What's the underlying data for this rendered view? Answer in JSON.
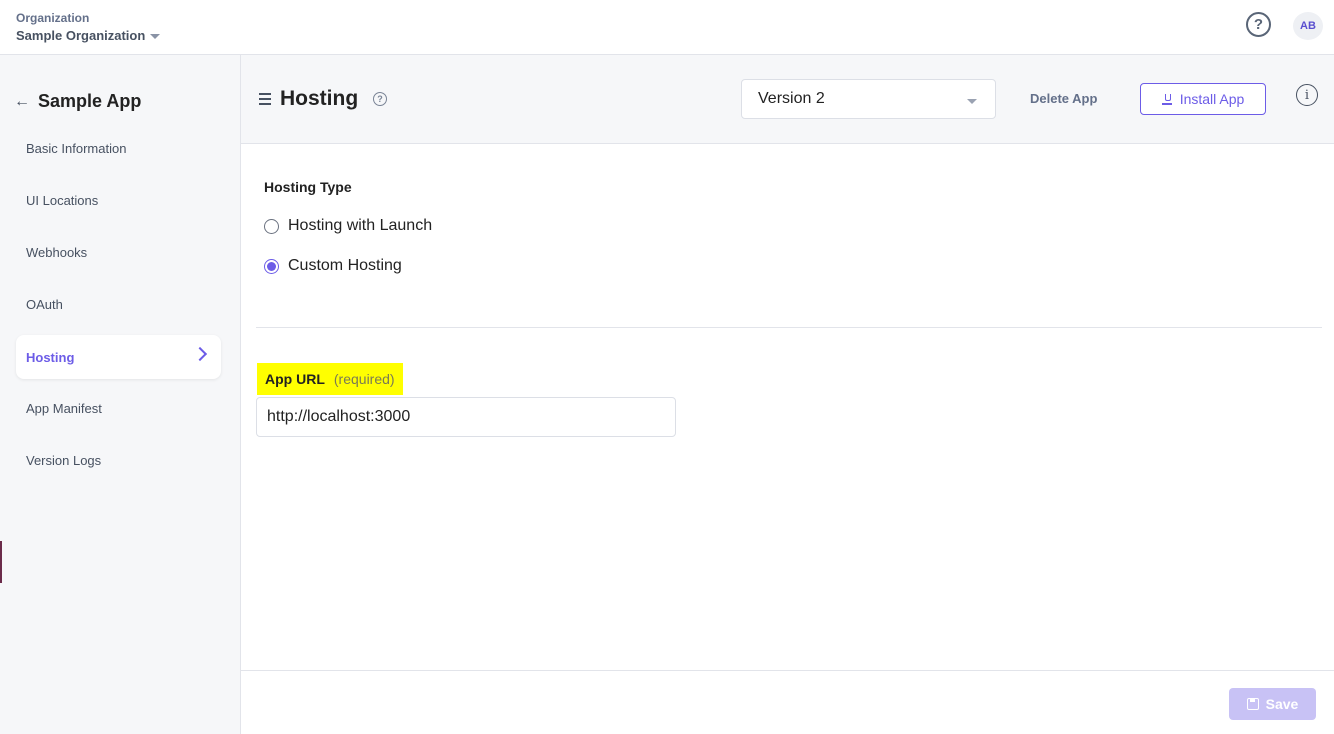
{
  "topbar": {
    "org_label": "Organization",
    "org_name": "Sample Organization",
    "help_glyph": "?",
    "avatar_initials": "AB"
  },
  "sidebar": {
    "back_icon": "arrow-left-icon",
    "app_title": "Sample App",
    "items": [
      {
        "label": "Basic Information",
        "active": false
      },
      {
        "label": "UI Locations",
        "active": false
      },
      {
        "label": "Webhooks",
        "active": false
      },
      {
        "label": "OAuth",
        "active": false
      },
      {
        "label": "Hosting",
        "active": true
      },
      {
        "label": "App Manifest",
        "active": false
      },
      {
        "label": "Version Logs",
        "active": false
      }
    ]
  },
  "header": {
    "title": "Hosting",
    "help_glyph": "?",
    "version_selected": "Version 2",
    "delete_label": "Delete App",
    "install_label": "Install App",
    "info_glyph": "i"
  },
  "hosting": {
    "section_label": "Hosting Type",
    "options": [
      {
        "label": "Hosting with Launch",
        "selected": false
      },
      {
        "label": "Custom Hosting",
        "selected": true
      }
    ]
  },
  "app_url": {
    "label": "App URL",
    "required_text": "(required)",
    "value": "http://localhost:3000"
  },
  "footer": {
    "save_label": "Save"
  },
  "colors": {
    "accent": "#6c5ce7",
    "highlight": "#ffff00",
    "save_disabled": "#c8c2f5"
  }
}
